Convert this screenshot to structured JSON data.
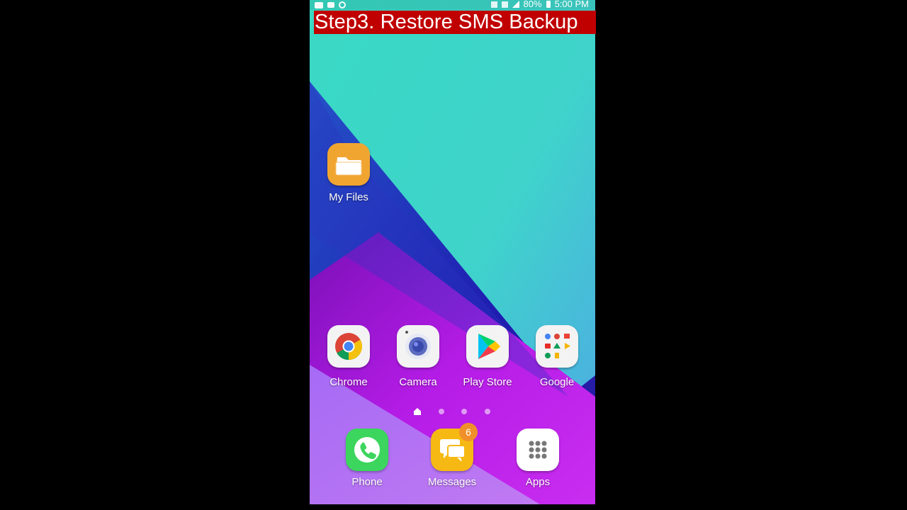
{
  "status_bar": {
    "battery": "80%",
    "time": "5:00 PM",
    "left_icons": [
      "message-icon",
      "video-icon",
      "sync-icon"
    ],
    "right_icons": [
      "nfc-icon",
      "wifi-icon",
      "signal-icon",
      "battery-icon"
    ]
  },
  "banner": {
    "text": "Step3. Restore SMS Backup",
    "background": "#c00000"
  },
  "home": {
    "desktop_apps": [
      {
        "label": "My Files",
        "icon": "folder-icon"
      }
    ],
    "row_apps": [
      {
        "label": "Chrome",
        "icon": "chrome-icon"
      },
      {
        "label": "Camera",
        "icon": "camera-icon"
      },
      {
        "label": "Play Store",
        "icon": "play-store-icon"
      },
      {
        "label": "Google",
        "icon": "google-folder-icon"
      }
    ],
    "page_indicator": {
      "pages": 4,
      "current": 0
    },
    "dock": [
      {
        "label": "Phone",
        "icon": "phone-icon"
      },
      {
        "label": "Messages",
        "icon": "messages-icon",
        "badge": "6"
      },
      {
        "label": "Apps",
        "icon": "apps-grid-icon"
      }
    ]
  },
  "colors": {
    "teal": "#3fd3c9",
    "blue": "#2d2fb8",
    "magenta": "#b51ce6",
    "lavender": "#b06cf0",
    "phone_green": "#3cd55e",
    "messages_yellow": "#f6b913",
    "folder_orange": "#f1a531",
    "badge_orange": "#f0902a"
  }
}
